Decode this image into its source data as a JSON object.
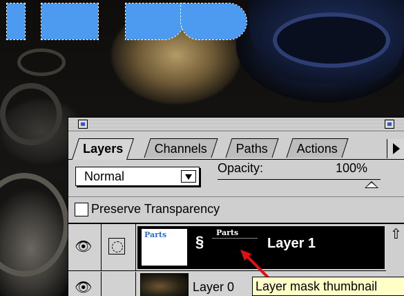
{
  "tabs": [
    {
      "label": "Layers"
    },
    {
      "label": "Channels"
    },
    {
      "label": "Paths"
    },
    {
      "label": "Actions"
    }
  ],
  "blend_mode": {
    "selected": "Normal"
  },
  "opacity": {
    "label": "Opacity:",
    "value": "100%"
  },
  "preserve_transparency": {
    "label": "Preserve Transparency",
    "checked": false
  },
  "layers": [
    {
      "name": "Layer 1",
      "thumb_text": "Parts",
      "mask_text": "Parts",
      "selected": true
    },
    {
      "name": "Layer 0",
      "selected": false
    }
  ],
  "tooltip": {
    "text": "Layer mask thumbnail"
  },
  "colors": {
    "selection": "#4d9bf0",
    "annotation_arrow": "#e01010",
    "tooltip_bg": "#ffffc8"
  },
  "icons": [
    "eye-icon",
    "mask-mode-icon",
    "link-icon",
    "scroll-up-icon",
    "expand-arrow-icon"
  ]
}
